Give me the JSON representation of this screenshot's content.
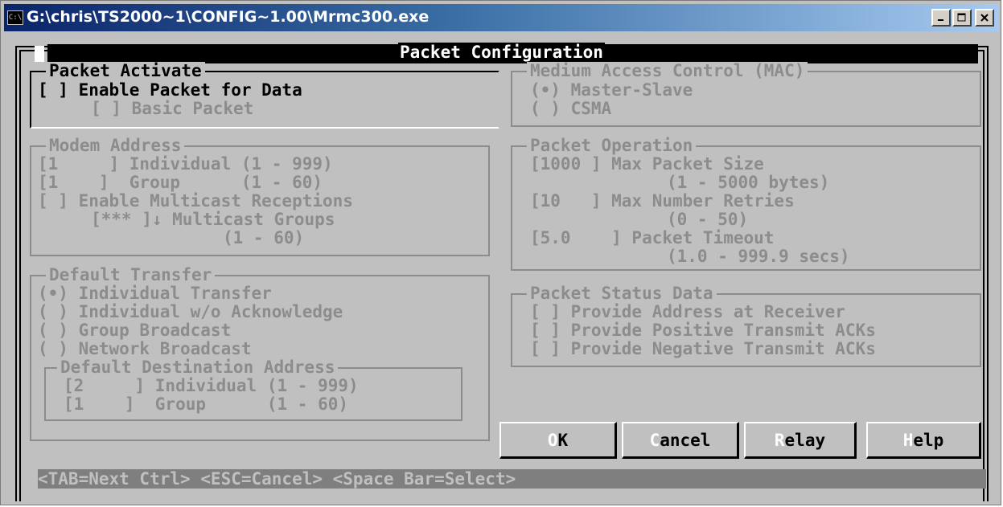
{
  "window": {
    "title": "G:\\chris\\TS2000~1\\CONFIG~1.00\\Mrmc300.exe",
    "icon": "console-icon",
    "controls": [
      "minimize",
      "maximize",
      "close"
    ]
  },
  "dialog": {
    "title": "Packet Configuration",
    "corner_marker": "▐"
  },
  "packet_activate": {
    "legend": "Packet Activate",
    "enable": "[ ] Enable Packet for Data",
    "basic": "[ ] Basic Packet"
  },
  "mac": {
    "legend": "Medium Access Control (MAC)",
    "master_slave": "(•) Master-Slave",
    "csma": "( ) CSMA"
  },
  "modem_address": {
    "legend": "Modem Address",
    "individual": "[1     ] Individual (1 - 999)",
    "group": "[1    ]  Group      (1 - 60)",
    "multicast": "[ ] Enable Multicast Receptions",
    "multicast_groups": "[*** ]↓ Multicast Groups",
    "multicast_range": "(1 - 60)"
  },
  "packet_operation": {
    "legend": "Packet Operation",
    "max_size": "[1000 ] Max Packet Size",
    "max_size_range": "(1 - 5000 bytes)",
    "retries": "[10   ] Max Number Retries",
    "retries_range": "(0 - 50)",
    "timeout": "[5.0    ] Packet Timeout",
    "timeout_range": "(1.0 - 999.9 secs)"
  },
  "default_transfer": {
    "legend": "Default Transfer",
    "individual": "(•) Individual Transfer",
    "individual_noack": "( ) Individual w/o Acknowledge",
    "group": "( ) Group Broadcast",
    "network": "( ) Network Broadcast",
    "dest_legend": "Default Destination Address",
    "dest_individual": "[2     ] Individual (1 - 999)",
    "dest_group": "[1    ]  Group      (1 - 60)"
  },
  "status_data": {
    "legend": "Packet Status Data",
    "address": "[ ] Provide Address at Receiver",
    "positive": "[ ] Provide Positive Transmit ACKs",
    "negative": "[ ] Provide Negative Transmit ACKs"
  },
  "buttons": {
    "ok_hot": "O",
    "ok_rest": "K",
    "cancel_hot": "C",
    "cancel_rest": "ancel",
    "relay_hot": "R",
    "relay_rest": "elay",
    "help_hot": "H",
    "help_rest": "elp"
  },
  "status_bar": "<TAB=Next Ctrl> <ESC=Cancel> <Space Bar=Select>"
}
